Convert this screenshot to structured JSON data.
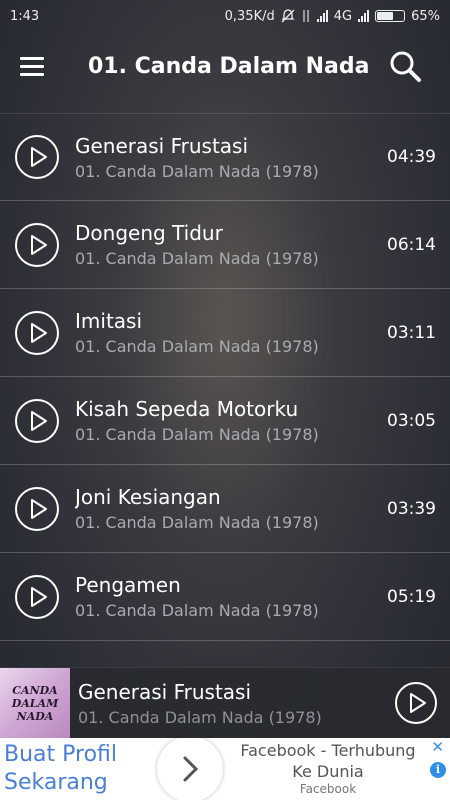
{
  "status_bar": {
    "time": "1:43",
    "network_speed": "0,35K/d",
    "network_type": "4G",
    "battery_percent": "65%",
    "battery_level": 0.65
  },
  "app_bar": {
    "title": "01. Canda Dalam Nada",
    "menu_icon": "hamburger-menu-icon",
    "search_icon": "search-icon"
  },
  "tracks": [
    {
      "title": "Generasi Frustasi",
      "album": "01. Canda Dalam Nada (1978)",
      "duration": "04:39"
    },
    {
      "title": "Dongeng Tidur",
      "album": "01. Canda Dalam Nada (1978)",
      "duration": "06:14"
    },
    {
      "title": "Imitasi",
      "album": "01. Canda Dalam Nada (1978)",
      "duration": "03:11"
    },
    {
      "title": "Kisah Sepeda Motorku",
      "album": "01. Canda Dalam Nada (1978)",
      "duration": "03:05"
    },
    {
      "title": "Joni Kesiangan",
      "album": "01. Canda Dalam Nada (1978)",
      "duration": "03:39"
    },
    {
      "title": "Pengamen",
      "album": "01. Canda Dalam Nada (1978)",
      "duration": "05:19"
    }
  ],
  "now_playing": {
    "title": "Generasi Frustasi",
    "album": "01. Canda Dalam Nada (1978)",
    "art_lines": [
      "CANDA",
      "DALAM",
      "NADA"
    ]
  },
  "ad": {
    "left_text_line1": "Buat Profil",
    "left_text_line2": "Sekarang",
    "headline_line1": "Facebook - Terhubung",
    "headline_line2": "Ke Dunia",
    "source": "Facebook",
    "close": "✕",
    "info": "i"
  },
  "colors": {
    "accent": "#ffffff",
    "subtitle": "#a9abb2",
    "ad_text": "#4a7fd6"
  }
}
